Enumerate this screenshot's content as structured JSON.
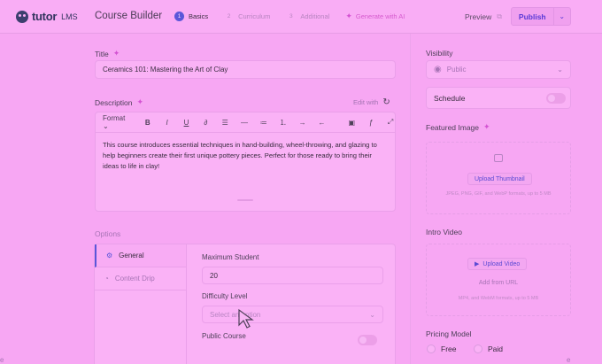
{
  "app": {
    "logo": "tutor",
    "logo_sub": "LMS",
    "title": "Course Builder"
  },
  "steps": [
    {
      "num": "1",
      "label": "Basics",
      "active": true
    },
    {
      "num": "2",
      "label": "Curriculum",
      "active": false
    },
    {
      "num": "3",
      "label": "Additional",
      "active": false
    }
  ],
  "ai_step": "Generate with AI",
  "header": {
    "preview": "Preview",
    "publish": "Publish"
  },
  "title_section": {
    "label": "Title",
    "value": "Ceramics 101: Mastering the Art of Clay"
  },
  "description": {
    "label": "Description",
    "edit_with": "Edit with",
    "format_label": "Format",
    "text": "This course introduces essential techniques in hand-building, wheel-throwing, and glazing to help beginners create their first unique pottery pieces. Perfect for those ready to bring their ideas to life in clay!"
  },
  "options": {
    "label": "Options",
    "tabs": [
      {
        "label": "General",
        "active": true
      },
      {
        "label": "Content Drip",
        "active": false
      }
    ],
    "max_student_label": "Maximum Student",
    "max_student_value": "20",
    "difficulty_label": "Difficulty Level",
    "difficulty_placeholder": "Select an option",
    "public_course_label": "Public Course"
  },
  "sidebar": {
    "visibility_label": "Visibility",
    "visibility_value": "Public",
    "schedule_label": "Schedule",
    "featured_image_label": "Featured Image",
    "upload_thumbnail": "Upload Thumbnail",
    "thumbnail_hint": "JPEG, PNG, GIF, and WebP formats, up to 5 MB",
    "intro_video_label": "Intro Video",
    "upload_video": "Upload Video",
    "add_from_url": "Add from URL",
    "video_hint": "MP4, and WebM formats, up to 5 MB",
    "pricing_label": "Pricing Model",
    "pricing_options": [
      "Free",
      "Paid"
    ]
  },
  "edge": {
    "left": "e",
    "right": "e"
  },
  "colors": {
    "overlay": "#f7a7f3",
    "accent": "#5a56d9",
    "ai": "#d453d2"
  }
}
